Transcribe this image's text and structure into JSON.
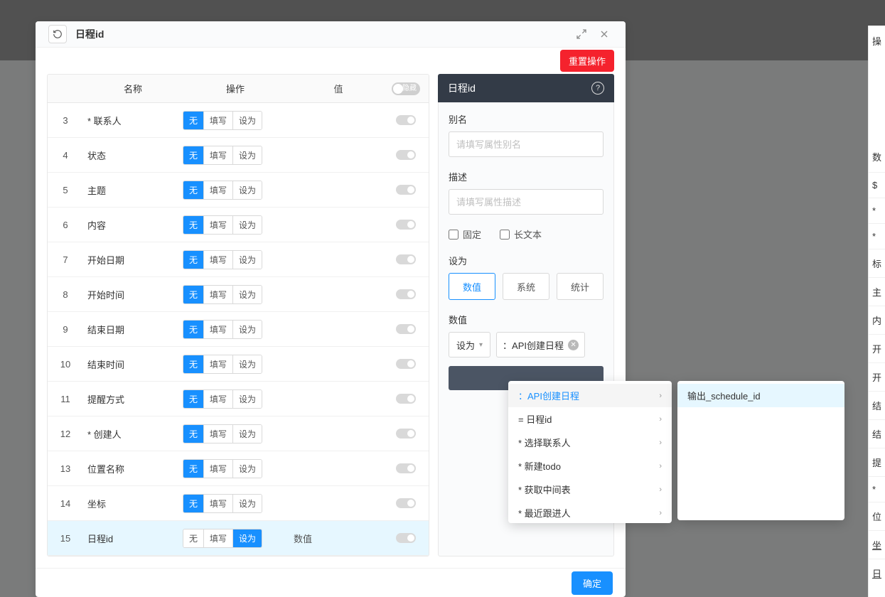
{
  "modal": {
    "title": "日程id",
    "reset_label": "重置操作",
    "confirm_label": "确定"
  },
  "table": {
    "headers": {
      "name": "名称",
      "operation": "操作",
      "value": "值",
      "headerToggleLabel": "隐藏"
    },
    "segLabels": {
      "none": "无",
      "fill": "填写",
      "setTo": "设为"
    },
    "rows": [
      {
        "index": "3",
        "name": "* 联系人",
        "active": 0,
        "value": "",
        "selected": false
      },
      {
        "index": "4",
        "name": "状态",
        "active": 0,
        "value": "",
        "selected": false
      },
      {
        "index": "5",
        "name": "主题",
        "active": 0,
        "value": "",
        "selected": false
      },
      {
        "index": "6",
        "name": "内容",
        "active": 0,
        "value": "",
        "selected": false
      },
      {
        "index": "7",
        "name": "开始日期",
        "active": 0,
        "value": "",
        "selected": false
      },
      {
        "index": "8",
        "name": "开始时间",
        "active": 0,
        "value": "",
        "selected": false
      },
      {
        "index": "9",
        "name": "结束日期",
        "active": 0,
        "value": "",
        "selected": false
      },
      {
        "index": "10",
        "name": "结束时间",
        "active": 0,
        "value": "",
        "selected": false
      },
      {
        "index": "11",
        "name": "提醒方式",
        "active": 0,
        "value": "",
        "selected": false
      },
      {
        "index": "12",
        "name": "* 创建人",
        "active": 0,
        "value": "",
        "selected": false
      },
      {
        "index": "13",
        "name": "位置名称",
        "active": 0,
        "value": "",
        "selected": false
      },
      {
        "index": "14",
        "name": "坐标",
        "active": 0,
        "value": "",
        "selected": false
      },
      {
        "index": "15",
        "name": "日程id",
        "active": 2,
        "value": "数值",
        "selected": true
      }
    ]
  },
  "panel": {
    "title": "日程id",
    "alias_label": "别名",
    "alias_placeholder": "请填写属性别名",
    "desc_label": "描述",
    "desc_placeholder": "请填写属性描述",
    "check_fixed": "固定",
    "check_longtext": "长文本",
    "setto_label": "设为",
    "tabs": {
      "value": "数值",
      "system": "系统",
      "stat": "统计"
    },
    "value_label": "数值",
    "select_text": "设为",
    "tag_text": "：API创建日程"
  },
  "dropdown1": {
    "items": [
      {
        "label": "：API创建日程",
        "active": true
      },
      {
        "label": "= 日程id"
      },
      {
        "label": "* 选择联系人"
      },
      {
        "label": "* 新建todo"
      },
      {
        "label": "* 获取中间表"
      },
      {
        "label": "* 最近跟进人"
      }
    ]
  },
  "dropdown2": {
    "items": [
      {
        "label": "输出_schedule_id"
      }
    ]
  },
  "rightSidebar": {
    "label1": "操",
    "label2": "数",
    "rows": [
      "$",
      "*",
      "*",
      "标",
      "主",
      "内",
      "开",
      "开",
      "结",
      "结",
      "提",
      "*",
      "位",
      "坐",
      "日"
    ]
  }
}
